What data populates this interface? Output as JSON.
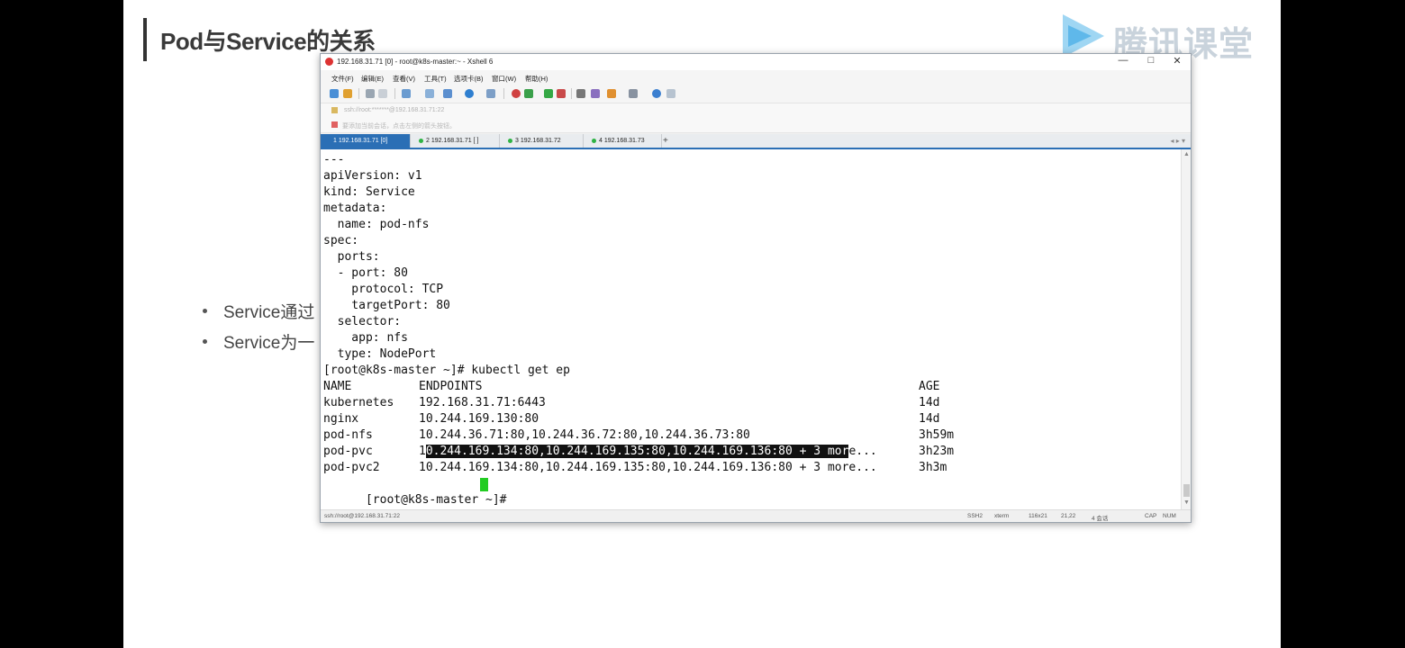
{
  "slide": {
    "title": "Pod与Service的关系",
    "bullets": [
      "Service通过",
      "Service为一"
    ],
    "logo_text": "腾讯课堂"
  },
  "window": {
    "title": "192.168.31.71 [0]   - root@k8s-master:~ - Xshell 6",
    "controls": [
      "—",
      "□",
      "✕"
    ]
  },
  "menu": [
    "文件(F)",
    "编辑(E)",
    "查看(V)",
    "工具(T)",
    "选项卡(B)",
    "窗口(W)",
    "帮助(H)"
  ],
  "address": "ssh://root:*******@192.168.31.71:22",
  "hint": "要添加当前会话，点击左侧的箭头按钮。",
  "tabs": [
    "1 192.168.31.71 [0]",
    "2 192.168.31.71 [ ]",
    "3 192.168.31.72",
    "4 192.168.31.73"
  ],
  "tab_controls": "◂ ▸  ▾",
  "terminal": {
    "lines": [
      "---",
      "apiVersion: v1",
      "kind: Service",
      "metadata:",
      "  name: pod-nfs",
      "spec:",
      "  ports:",
      "  - port: 80",
      "    protocol: TCP",
      "    targetPort: 80",
      "  selector:",
      "    app: nfs",
      "  type: NodePort",
      "[root@k8s-master ~]# kubectl get ep"
    ],
    "table_header": [
      "NAME",
      "ENDPOINTS",
      "AGE"
    ],
    "rows": [
      {
        "name": "kubernetes",
        "endpoints": "192.168.31.71:6443",
        "age": "14d"
      },
      {
        "name": "nginx",
        "endpoints": "10.244.169.130:80",
        "age": "14d"
      },
      {
        "name": "pod-nfs",
        "endpoints": "10.244.36.71:80,10.244.36.72:80,10.244.36.73:80",
        "age": "3h59m"
      },
      {
        "name": "pod-pvc",
        "endpoints_pre": "1",
        "endpoints_selected": "0.244.169.134:80,10.244.169.135:80,10.244.169.136:80 + 3 mor",
        "endpoints_post": "e...",
        "age": "3h23m"
      },
      {
        "name": "pod-pvc2",
        "endpoints": "10.244.169.134:80,10.244.169.135:80,10.244.169.136:80 + 3 more...",
        "age": "3h3m"
      }
    ],
    "prompt": "[root@k8s-master ~]# "
  },
  "status": {
    "session": "ssh://root@192.168.31.71:22",
    "protocol": "SSH2",
    "term": "xterm",
    "size": "116x21",
    "cursor": "21,22",
    "sessions": "4 会话",
    "caps": "CAP",
    "num": "NUM"
  }
}
